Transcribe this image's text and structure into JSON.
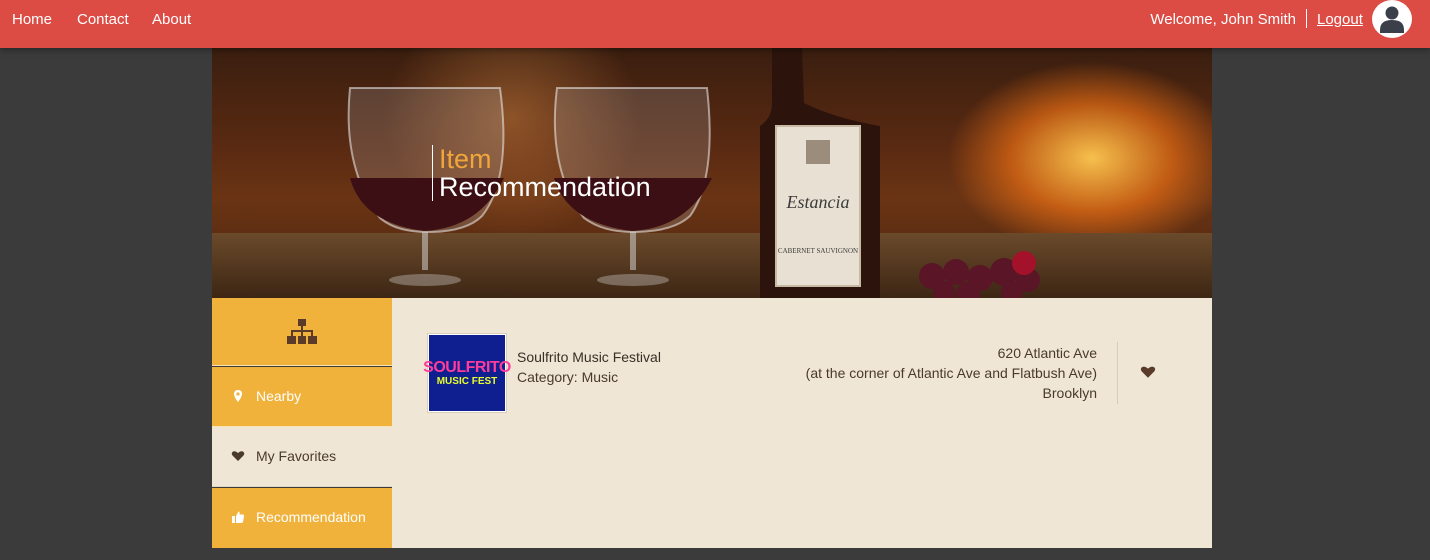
{
  "nav": {
    "links": [
      "Home",
      "Contact",
      "About"
    ],
    "welcome": "Welcome, John Smith",
    "logout": "Logout"
  },
  "hero": {
    "title_line1": "Item",
    "title_line2": "Recommendation"
  },
  "sidebar": {
    "top_icon": "sitemap-icon",
    "items": [
      {
        "label": "Nearby",
        "icon": "map-marker-icon"
      },
      {
        "label": "My Favorites",
        "icon": "heart-icon"
      },
      {
        "label": "Recommendation",
        "icon": "thumbs-up-icon"
      }
    ]
  },
  "item": {
    "name": "Soulfrito Music Festival",
    "category": "Category: Music",
    "logo_text_1": "SOULFRITO",
    "logo_text_2": "MUSIC FEST",
    "address": [
      "620 Atlantic Ave",
      "(at the corner of Atlantic Ave and Flatbush Ave)",
      "Brooklyn"
    ],
    "favorite_icon": "heart-icon"
  },
  "colors": {
    "nav_bg": "#dc4c45",
    "sidebar_accent": "#f0b23a",
    "content_bg": "#efe6d5",
    "title_accent": "#f0a63a",
    "page_bg": "#3b3b3b"
  }
}
